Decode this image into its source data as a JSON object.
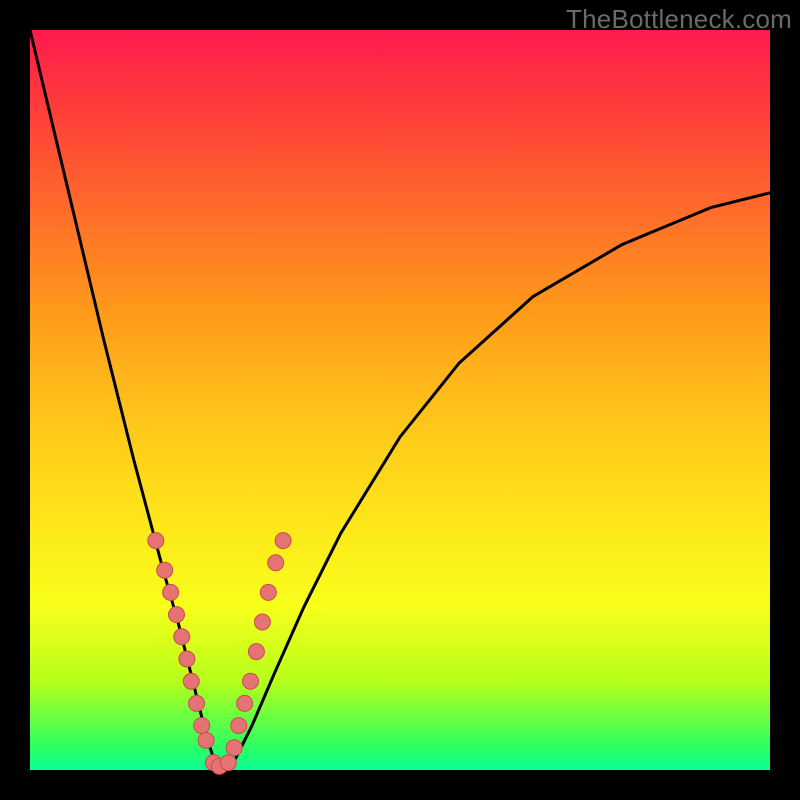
{
  "watermark": "TheBottleneck.com",
  "colors": {
    "background": "#000000",
    "gradient_top": "#ff1a4d",
    "gradient_mid1": "#ff9a1a",
    "gradient_mid2": "#ffe31a",
    "gradient_bottom": "#0bff98",
    "curve": "#000000",
    "dot_fill": "#e57373",
    "dot_stroke": "#c94d4d"
  },
  "chart_data": {
    "type": "line",
    "title": "",
    "xlabel": "",
    "ylabel": "",
    "xlim": [
      0,
      100
    ],
    "ylim": [
      0,
      100
    ],
    "grid": false,
    "legend": false,
    "series": [
      {
        "name": "bottleneck-curve",
        "x": [
          0,
          5,
          10,
          14,
          18,
          20,
          22,
          23,
          24,
          25,
          26,
          27,
          28,
          30,
          33,
          37,
          42,
          50,
          58,
          68,
          80,
          92,
          100
        ],
        "y": [
          100,
          79,
          58,
          42,
          27,
          20,
          12,
          8,
          4,
          1,
          0,
          0,
          2,
          6,
          13,
          22,
          32,
          45,
          55,
          64,
          71,
          76,
          78
        ]
      }
    ],
    "markers": {
      "name": "highlighted-points",
      "x": [
        17.0,
        18.2,
        19.0,
        19.8,
        20.5,
        21.2,
        21.8,
        22.5,
        23.2,
        23.8,
        24.8,
        25.6,
        26.8,
        27.6,
        28.2,
        29.0,
        29.8,
        30.6,
        31.4,
        32.2,
        33.2,
        34.2
      ],
      "y": [
        31,
        27,
        24,
        21,
        18,
        15,
        12,
        9,
        6,
        4,
        1,
        0.5,
        1,
        3,
        6,
        9,
        12,
        16,
        20,
        24,
        28,
        31
      ]
    }
  }
}
